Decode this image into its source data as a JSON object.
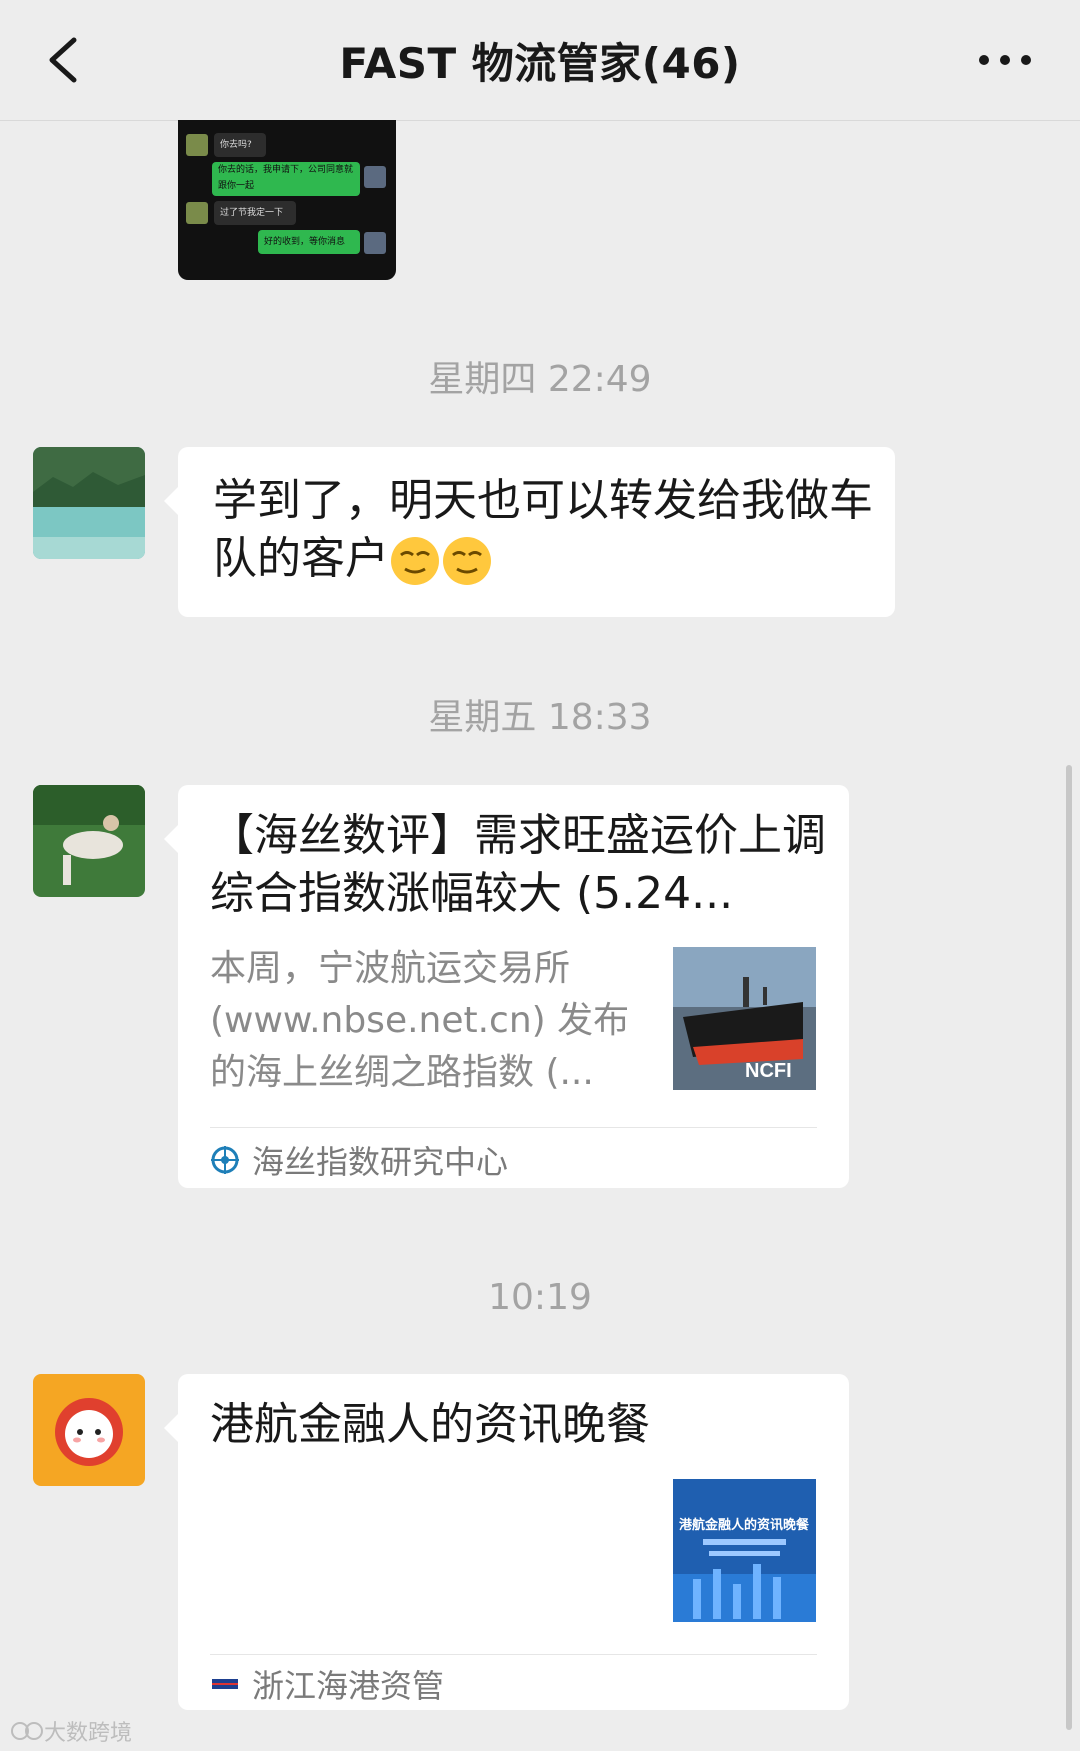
{
  "header": {
    "title": "FAST 物流管家(46)",
    "back_icon": "chevron-left-icon",
    "more_icon": "more-dots-icon"
  },
  "forwarded_screenshot": {
    "lines": [
      "你去吗?",
      "你去的话，我申请下，公司同意就跟你一起",
      "过了节我定一下",
      "好的收到，等你消息"
    ]
  },
  "messages": [
    {
      "timestamp": "星期四 22:49",
      "type": "text",
      "text": "学到了，明天也可以转发给我做车队的客户",
      "emoji": "sly-smile-emoji"
    },
    {
      "timestamp": "星期五 18:33",
      "type": "article",
      "title": "【海丝数评】需求旺盛运价上调 综合指数涨幅较大 (5.24...",
      "description": "本周，宁波航运交易所(www.nbse.net.cn) 发布的海上丝绸之路指数 (...",
      "thumbnail_label": "NCFI",
      "source": "海丝指数研究中心"
    },
    {
      "timestamp": "10:19",
      "type": "article",
      "title": "港航金融人的资讯晚餐",
      "thumbnail_label": "港航金融人的资讯晚餐",
      "source": "浙江海港资管"
    }
  ],
  "watermark": "大数跨境",
  "colors": {
    "background": "#ededed",
    "bubble": "#ffffff",
    "timestamp": "#a3a3a3",
    "wechat_green": "#95ec69"
  }
}
